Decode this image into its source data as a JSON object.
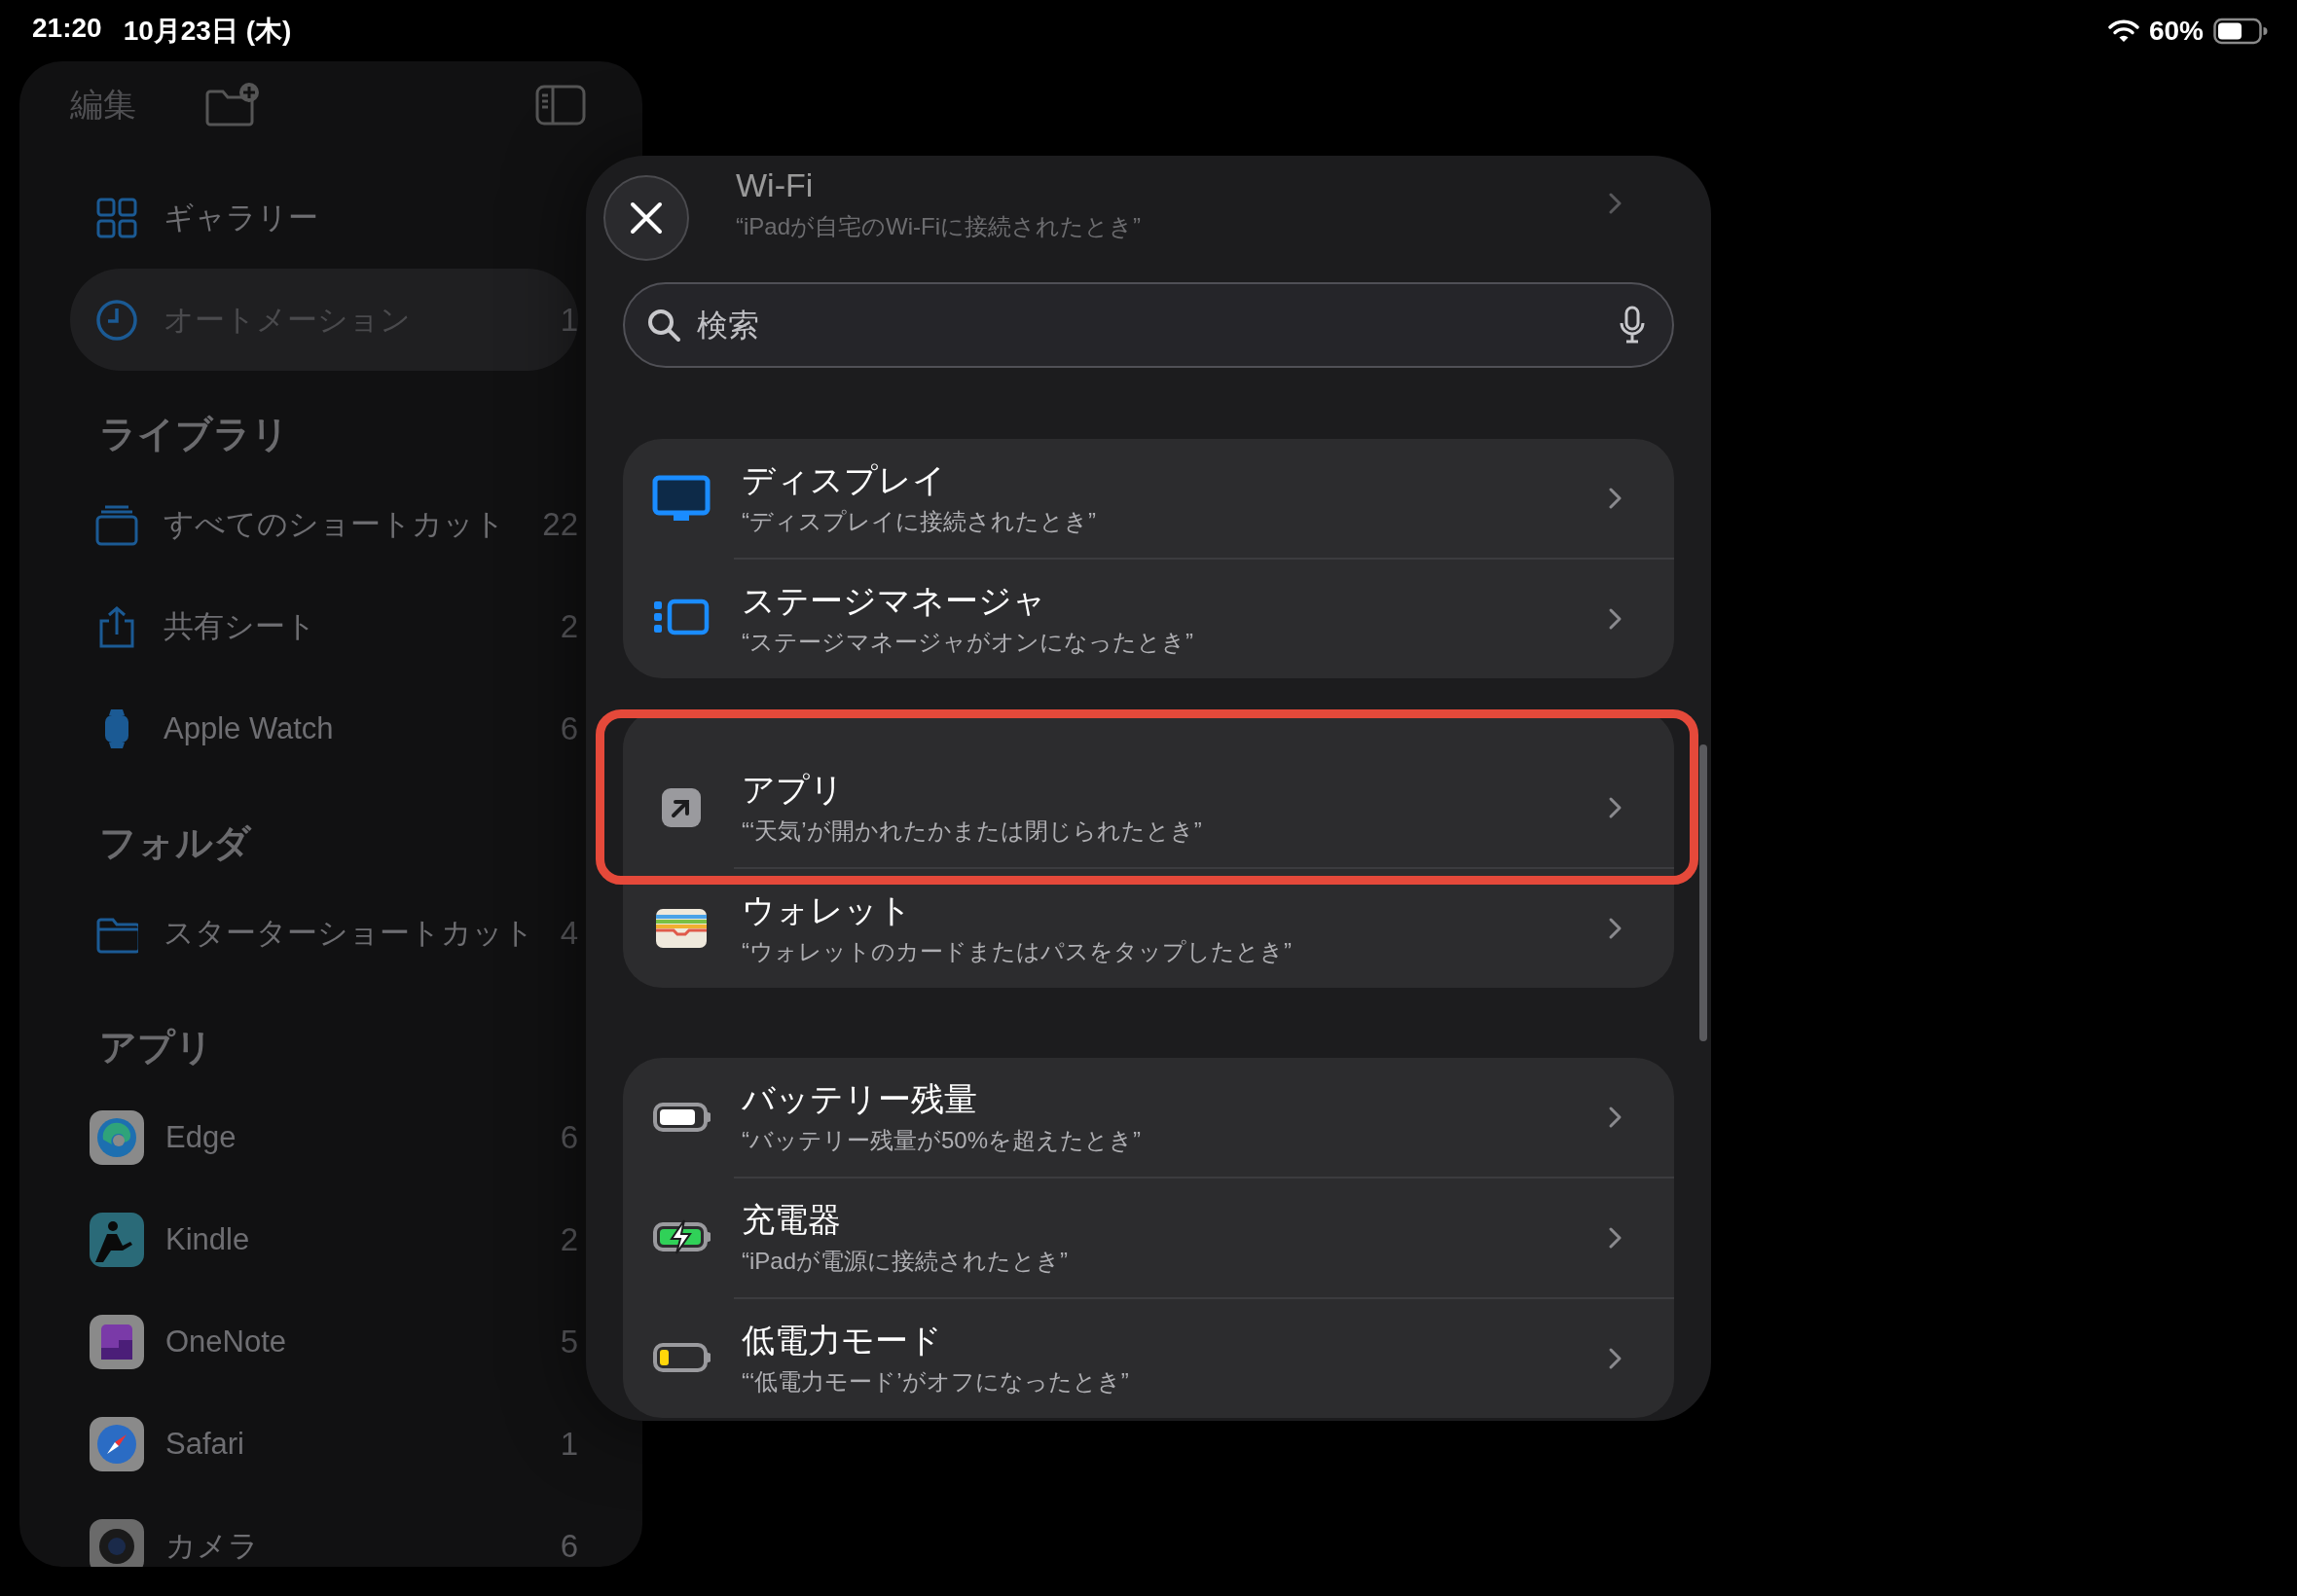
{
  "status_bar": {
    "time": "21:20",
    "date": "10月23日 (木)",
    "battery": "60%"
  },
  "sidebar": {
    "edit_label": "編集",
    "sections": [
      {
        "items": [
          {
            "label": "ギャラリー",
            "selected": false
          },
          {
            "label": "オートメーション",
            "count": "1",
            "selected": true
          }
        ]
      },
      {
        "title": "ライブラリ",
        "items": [
          {
            "label": "すべてのショートカット",
            "count": "22",
            "selected": false
          },
          {
            "label": "共有シート",
            "count": "2",
            "selected": false
          },
          {
            "label": "Apple Watch",
            "count": "6",
            "selected": false
          }
        ]
      },
      {
        "title": "フォルダ",
        "items": [
          {
            "label": "スターターショートカット",
            "count": "4",
            "selected": false
          }
        ]
      },
      {
        "title": "アプリ",
        "items": [
          {
            "label": "Edge",
            "count": "6",
            "selected": false
          },
          {
            "label": "Kindle",
            "count": "2",
            "selected": false
          },
          {
            "label": "OneNote",
            "count": "5",
            "selected": false
          },
          {
            "label": "Safari",
            "count": "1",
            "selected": false
          },
          {
            "label": "カメラ",
            "count": "6",
            "selected": false
          }
        ]
      }
    ]
  },
  "sheet": {
    "search": {
      "placeholder": "検索"
    },
    "faded_row": {
      "title": "Wi-Fi",
      "subtitle": "“iPadが自宅のWi-Fiに接続されたとき”"
    },
    "groups": [
      {
        "rows": [
          {
            "title": "ディスプレイ",
            "subtitle": "“ディスプレイに接続されたとき”",
            "highlighted": false
          },
          {
            "title": "ステージマネージャ",
            "subtitle": "“ステージマネージャがオンになったとき”",
            "highlighted": false
          }
        ]
      },
      {
        "rows": [
          {
            "title": "アプリ",
            "subtitle": "“‘天気’が開かれたかまたは閉じられたとき”",
            "highlighted": true
          },
          {
            "title": "ウォレット",
            "subtitle": "“ウォレットのカードまたはパスをタップしたとき”",
            "highlighted": false
          }
        ]
      },
      {
        "rows": [
          {
            "title": "バッテリー残量",
            "subtitle": "“バッテリー残量が50%を超えたとき”",
            "highlighted": false
          },
          {
            "title": "充電器",
            "subtitle": "“iPadが電源に接続されたとき”",
            "highlighted": false
          },
          {
            "title": "低電力モード",
            "subtitle": "“‘低電力モード’がオフになったとき”",
            "highlighted": false
          }
        ]
      }
    ]
  }
}
